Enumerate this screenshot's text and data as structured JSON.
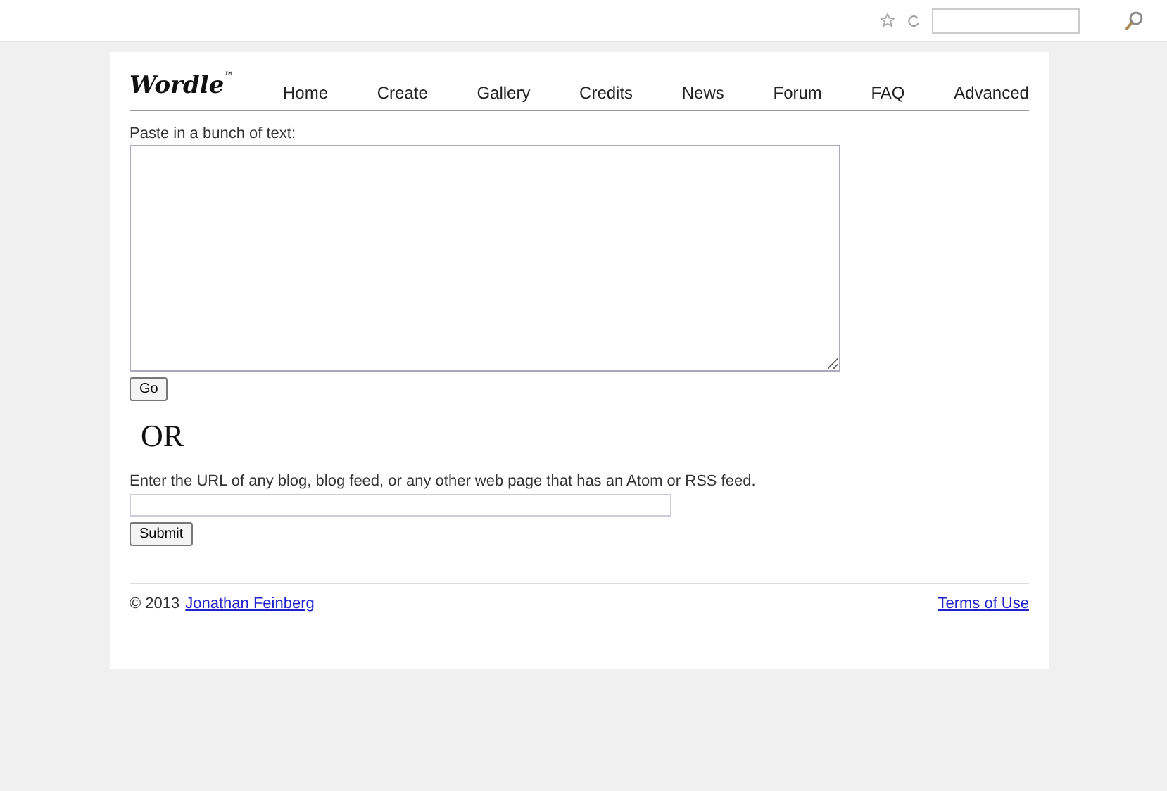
{
  "logo": {
    "text": "Wordle",
    "mark": "™"
  },
  "nav": [
    "Home",
    "Create",
    "Gallery",
    "Credits",
    "News",
    "Forum",
    "FAQ",
    "Advanced"
  ],
  "text_form": {
    "label": "Paste in a bunch of text:",
    "button": "Go"
  },
  "separator": "OR",
  "url_form": {
    "label": "Enter the URL of any blog, blog feed, or any other web page that has an Atom or RSS feed.",
    "button": "Submit"
  },
  "footer": {
    "copyright": "© 2013",
    "author": "Jonathan Feinberg",
    "terms": "Terms of Use"
  }
}
